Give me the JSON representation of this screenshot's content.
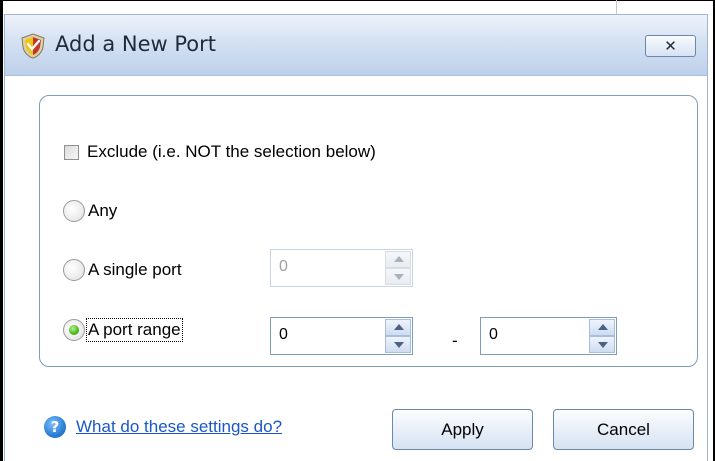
{
  "dialog": {
    "title": "Add a New Port",
    "close_label": "✕"
  },
  "options": {
    "exclude_label": "Exclude (i.e. NOT the selection below)",
    "exclude_checked": false,
    "any_label": "Any",
    "single_label": "A single port",
    "range_label": "A port range",
    "selected": "A port range"
  },
  "single_port": {
    "value": "0"
  },
  "port_range": {
    "from_value": "0",
    "separator": "-",
    "to_value": "0"
  },
  "footer": {
    "help_icon_glyph": "?",
    "help_link": "What do these settings do?",
    "apply_label": "Apply",
    "cancel_label": "Cancel"
  },
  "colors": {
    "titlebar": "#bdd0ea",
    "link": "#1a58c7",
    "radio_selected": "#4bb71a"
  },
  "icons": {
    "title": "shield-icon",
    "help": "help-icon"
  }
}
